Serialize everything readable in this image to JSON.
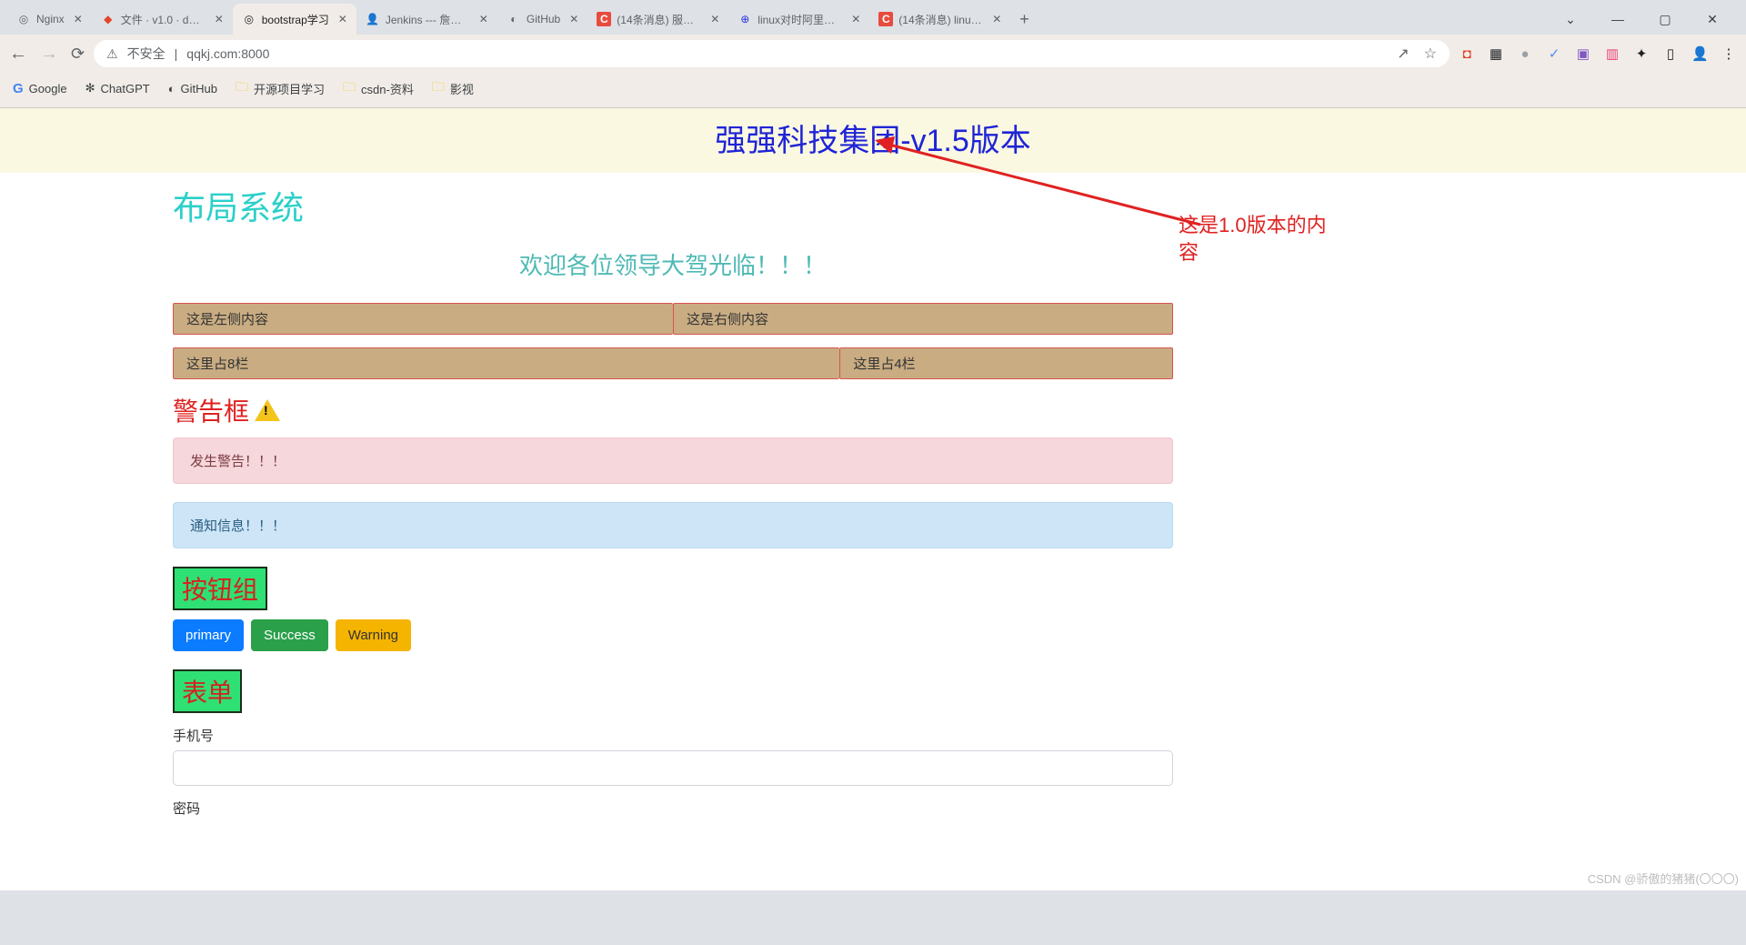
{
  "chrome": {
    "tabs": [
      {
        "title": "Nginx"
      },
      {
        "title": "文件 · v1.0 · dev…"
      },
      {
        "title": "bootstrap学习",
        "active": true
      },
      {
        "title": "Jenkins --- 詹金…"
      },
      {
        "title": "GitHub"
      },
      {
        "title": "(14条消息) 服务…"
      },
      {
        "title": "linux对时阿里云…"
      },
      {
        "title": "(14条消息) linux…"
      }
    ],
    "addr": {
      "secure": "不安全",
      "url": "qqkj.com:8000"
    },
    "bookmarks": [
      {
        "label": "Google",
        "kind": "site"
      },
      {
        "label": "ChatGPT",
        "kind": "site"
      },
      {
        "label": "GitHub",
        "kind": "site"
      },
      {
        "label": "开源项目学习",
        "kind": "folder"
      },
      {
        "label": "csdn-资料",
        "kind": "folder"
      },
      {
        "label": "影视",
        "kind": "folder"
      }
    ]
  },
  "page": {
    "banner": "强强科技集团-v1.5版本",
    "layout_title": "布局系统",
    "welcome": "欢迎各位领导大驾光临！！！",
    "grid": {
      "row1_left": "这是左侧内容",
      "row1_right": "这是右侧内容",
      "row2_left": "这里占8栏",
      "row2_right": "这里占4栏"
    },
    "sections": {
      "alert_heading": "警告框",
      "buttons_heading": "按钮组",
      "form_heading": "表单"
    },
    "alerts": {
      "danger": "发生警告！！！",
      "info": "通知信息！！！"
    },
    "buttons": {
      "primary": "primary",
      "success": "Success",
      "warning": "Warning"
    },
    "form": {
      "phone_label": "手机号",
      "pwd_label": "密码"
    },
    "annotation": "这是1.0版本的内容",
    "watermark": "CSDN @骄傲的猪猪(〇〇〇)"
  }
}
